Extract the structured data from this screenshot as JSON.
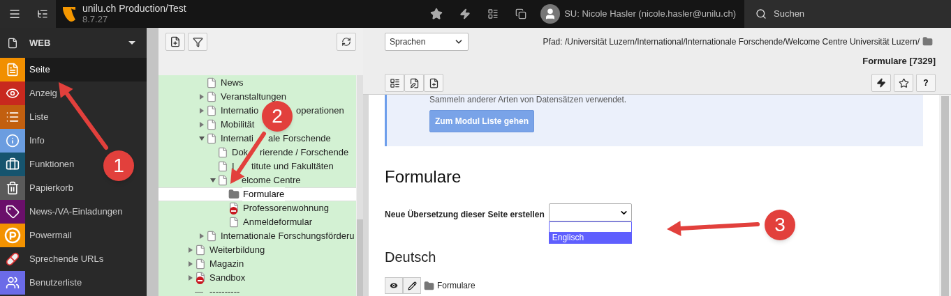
{
  "topbar": {
    "title": "unilu.ch Production/Test",
    "version": "8.7.27",
    "user": "SU: Nicole Hasler (nicole.hasler@unilu.ch)",
    "search": "Suchen"
  },
  "modules": {
    "section": "WEB",
    "items": [
      {
        "label": "Seite",
        "kind": "page",
        "color": "#f18f00",
        "selected": true
      },
      {
        "label": "Anzeig",
        "kind": "eye",
        "color": "#c8291e",
        "selected": false
      },
      {
        "label": "Liste",
        "kind": "list",
        "color": "#c25f0f",
        "selected": false
      },
      {
        "label": "Info",
        "kind": "info",
        "color": "#6b9de0",
        "selected": false
      },
      {
        "label": "Funktionen",
        "kind": "briefcase",
        "color": "#16546e",
        "selected": false
      },
      {
        "label": "Papierkorb",
        "kind": "trash",
        "color": "#5a5a5a",
        "selected": false
      },
      {
        "label": "News-/VA-Einladungen",
        "kind": "tag",
        "color": "#6a0f6a",
        "selected": false
      },
      {
        "label": "Powermail",
        "kind": "powermail",
        "color": "#f39200",
        "selected": false
      },
      {
        "label": "Sprechende URLs",
        "kind": "pill",
        "color": "#292929",
        "selected": false
      },
      {
        "label": "Benutzerliste",
        "kind": "users",
        "color": "#6b6be8",
        "selected": false
      }
    ]
  },
  "tree": {
    "branch": [
      {
        "kind": "page",
        "label": "News",
        "selected": false
      },
      {
        "kind": "page",
        "label": "Veranstaltungen",
        "expanded": false,
        "selected": false
      },
      {
        "kind": "page",
        "label": "Internatio",
        "label_rest": "operationen",
        "expanded": false,
        "selected": false
      },
      {
        "kind": "page",
        "label": "Mobilität",
        "expanded": false,
        "selected": false
      },
      {
        "kind": "page",
        "label": "Internati",
        "label_rest": "ale Forschende",
        "expanded": true,
        "selected": false,
        "children": [
          {
            "kind": "page",
            "label": "Dok",
            "label_rest": "rierende / Forschende",
            "selected": false
          },
          {
            "kind": "page",
            "label": "I",
            "label_rest": "titute und Fakultäten",
            "selected": false
          },
          {
            "kind": "page",
            "label": "elcome Centre",
            "expanded": true,
            "selected": false,
            "children": [
              {
                "kind": "folder",
                "label": "Formulare",
                "selected": true
              },
              {
                "kind": "hidden",
                "label": "Professorenwohnung",
                "selected": false
              },
              {
                "kind": "page",
                "label": "Anmeldeformular",
                "selected": false
              }
            ]
          }
        ]
      },
      {
        "kind": "page",
        "label": "Internationale Forschungsförderu",
        "expanded": false,
        "selected": false
      }
    ],
    "items": [
      {
        "kind": "page",
        "label": "Weiterbildung",
        "expanded": false,
        "selected": false
      },
      {
        "kind": "page",
        "label": "Magazin",
        "expanded": false,
        "selected": false
      },
      {
        "kind": "hidden",
        "label": "Sandbox",
        "expanded": false,
        "selected": false
      },
      {
        "kind": "separator",
        "label": "----------",
        "selected": false
      }
    ]
  },
  "docheader": {
    "language_select": "Sprachen",
    "path": "Pfad: /Universität Luzern/International/Internationale Forschende/Welcome Centre Universität Luzern/",
    "page": "Formulare [7329]",
    "help": "?"
  },
  "content": {
    "info_text": "Sammeln anderer Arten von Datensätzen verwendet.",
    "info_button": "Zum Modul Liste gehen",
    "heading": "Formulare",
    "translation_label": "Neue Übersetzung dieser Seite erstellen",
    "translation_options": [
      {
        "label": "Englisch",
        "selected": true
      }
    ],
    "language_heading": "Deutsch",
    "record": "Formulare"
  },
  "annotations": [
    "1",
    "2",
    "3"
  ]
}
